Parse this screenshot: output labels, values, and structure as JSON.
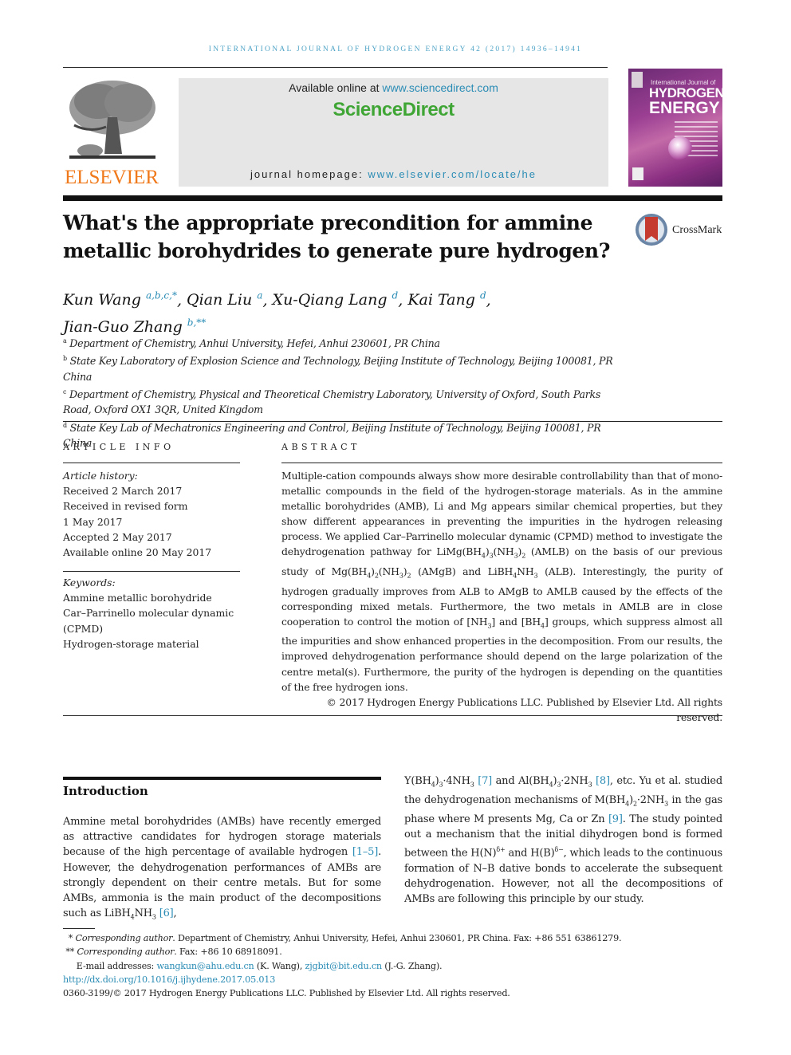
{
  "running_head": "International Journal of Hydrogen Energy 42 (2017) 14936–14941",
  "header": {
    "publisher_logo_text": "ELSEVIER",
    "available_online_prefix": "Available online at ",
    "available_online_link": "www.sciencedirect.com",
    "brand": "ScienceDirect",
    "homepage_prefix": "journal homepage: ",
    "homepage_link": "www.elsevier.com/locate/he",
    "cover": {
      "line1": "International Journal of",
      "line2": "HYDROGEN",
      "line3": "ENERGY"
    },
    "colors": {
      "elsevier_orange": "#f07a1b",
      "sciencedirect_green": "#3fa535",
      "link_blue": "#2a8cb5"
    }
  },
  "article": {
    "title": "What's the appropriate precondition for ammine metallic borohydrides to generate pure hydrogen?",
    "crossmark_label": "CrossMark",
    "authors": [
      {
        "name": "Kun Wang",
        "marks": "a,b,c,*",
        "sep": ", "
      },
      {
        "name": "Qian Liu",
        "marks": "a",
        "sep": ", "
      },
      {
        "name": "Xu-Qiang Lang",
        "marks": "d",
        "sep": ", "
      },
      {
        "name": "Kai Tang",
        "marks": "d",
        "sep": ","
      },
      {
        "name": "Jian-Guo Zhang",
        "marks": "b,**",
        "sep": ""
      }
    ],
    "affiliations": [
      {
        "mark": "a",
        "text": "Department of Chemistry, Anhui University, Hefei, Anhui 230601, PR China"
      },
      {
        "mark": "b",
        "text": "State Key Laboratory of Explosion Science and Technology, Beijing Institute of Technology, Beijing 100081, PR China"
      },
      {
        "mark": "c",
        "text": "Department of Chemistry, Physical and Theoretical Chemistry Laboratory, University of Oxford, South Parks Road, Oxford OX1 3QR, United Kingdom"
      },
      {
        "mark": "d",
        "text": "State Key Lab of Mechatronics Engineering and Control, Beijing Institute of Technology, Beijing 100081, PR China"
      }
    ]
  },
  "article_info": {
    "heading": "Article Info",
    "history_label": "Article history:",
    "history": [
      "Received 2 March 2017",
      "Received in revised form",
      "1 May 2017",
      "Accepted 2 May 2017",
      "Available online 20 May 2017"
    ],
    "keywords_label": "Keywords:",
    "keywords": [
      "Ammine metallic borohydride",
      "Car–Parrinello molecular dynamic",
      "(CPMD)",
      "Hydrogen-storage material"
    ]
  },
  "abstract": {
    "heading": "Abstract",
    "p1": "Multiple-cation compounds always show more desirable controllability than that of mono-metallic compounds in the field of the hydrogen-storage materials. As in the ammine metallic borohydrides (AMB), Li and Mg appears similar chemical properties, but they show different appearances in preventing the impurities in the hydrogen releasing process. We applied Car–Parrinello molecular dynamic (CPMD) method to investigate the dehydrogenation pathway for ",
    "f_amlb": [
      "LiMg(BH",
      "4",
      ")",
      "3",
      "(NH",
      "3",
      ")",
      "2"
    ],
    "p2": " (AMLB) on the basis of our previous study of ",
    "f_amgb": [
      "Mg(BH",
      "4",
      ")",
      "2",
      "(NH",
      "3",
      ")",
      "2"
    ],
    "p3": " (AMgB) and ",
    "f_alb": [
      "LiBH",
      "4",
      "NH",
      "3"
    ],
    "p4": " (ALB). Interestingly, the purity of hydrogen gradually improves from ALB to AMgB to AMLB caused by the effects of the corresponding mixed metals. Furthermore, the two metals in AMLB are in close cooperation to control the motion of ",
    "f_nh3": [
      "[NH",
      "3",
      "]"
    ],
    "p5": " and ",
    "f_bh4": [
      "[BH",
      "4",
      "]"
    ],
    "p6": " groups, which suppress almost all the impurities and show enhanced properties in the decomposition. From our results, the improved dehydrogenation performance should depend on the large polarization of the centre metal(s). Furthermore, the purity of the hydrogen is depending on the quantities of the free hydrogen ions.",
    "copyright": "© 2017 Hydrogen Energy Publications LLC. Published by Elsevier Ltd. All rights reserved."
  },
  "introduction": {
    "heading": "Introduction",
    "left_a": "Ammine metal borohydrides (AMBs) have recently emerged as attractive candidates for hydrogen storage materials because of the high percentage of available hydrogen ",
    "ref_1_5": "[1–5]",
    "left_b": ". However, the dehydrogenation performances of AMBs are strongly dependent on their centre metals. But for some AMBs, ammonia is the main product of the decompositions such as LiBH",
    "left_sub4": "4",
    "left_c": "NH",
    "left_sub3": "3",
    "ref_6": "[6]",
    "left_d": ",",
    "right_a1": "Y(BH",
    "right_a2": ")",
    "right_a3": "·4NH",
    "ref_7": "[7]",
    "right_b1": " and Al(BH",
    "right_b2": "·2NH",
    "ref_8": "[8]",
    "right_c": ", etc. Yu et al. studied the dehydrogenation mechanisms of M(BH",
    "right_d": "·2NH",
    "right_e": " in the gas phase where M presents Mg, Ca or Zn ",
    "ref_9": "[9]",
    "right_f": ". The study pointed out a mechanism that the initial dihydrogen bond is formed between the H(N)",
    "delta_plus": "δ+",
    "right_g": " and H(B)",
    "delta_minus": "δ−",
    "right_h": ", which leads to the continuous formation of N–B dative bonds to accelerate the subsequent dehydrogenation. However, not all the decompositions of AMBs are following this principle by our study."
  },
  "footnotes": {
    "fn1_mark": "*",
    "fn1_label": "Corresponding author",
    "fn1_text": ". Department of Chemistry, Anhui University, Hefei, Anhui 230601, PR China. Fax: +86 551 63861279.",
    "fn2_mark": "**",
    "fn2_label": "Corresponding author",
    "fn2_text": ". Fax: +86 10 68918091.",
    "email_prefix": "E-mail addresses: ",
    "email1": "wangkun@ahu.edu.cn",
    "email1_who": " (K. Wang), ",
    "email2": "zjgbit@bit.edu.cn",
    "email2_who": " (J.-G. Zhang).",
    "doi": "http://dx.doi.org/10.1016/j.ijhydene.2017.05.013",
    "issn_line": "0360-3199/© 2017 Hydrogen Energy Publications LLC. Published by Elsevier Ltd. All rights reserved."
  }
}
